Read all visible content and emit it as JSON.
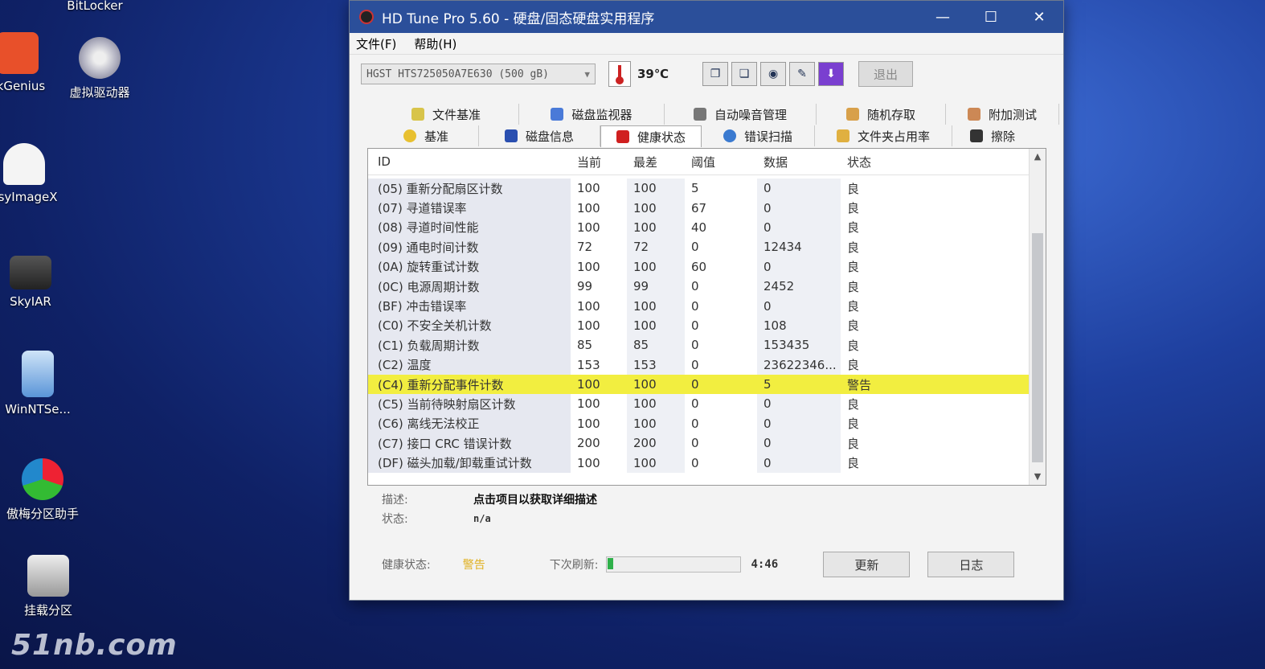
{
  "desktop": {
    "icons": [
      {
        "label": "BitLocker"
      },
      {
        "label": "skGenius"
      },
      {
        "label": "虚拟驱动器"
      },
      {
        "label": "asyImageX"
      },
      {
        "label": "SkyIAR"
      },
      {
        "label": "WinNTSe..."
      },
      {
        "label": "傲梅分区助手"
      },
      {
        "label": "挂载分区"
      }
    ],
    "watermark": "51nb.com"
  },
  "window": {
    "title": "HD Tune Pro 5.60 - 硬盘/固态硬盘实用程序",
    "minimize": "—",
    "maximize": "☐",
    "close": "✕"
  },
  "menu": {
    "file": "文件(F)",
    "help": "帮助(H)"
  },
  "toolbar": {
    "drive": "HGST HTS725050A7E630 (500 gB)",
    "temperature": "39℃",
    "exit_label": "退出"
  },
  "tabs": {
    "row1": [
      "文件基准",
      "磁盘监视器",
      "自动噪音管理",
      "随机存取",
      "附加测试"
    ],
    "row2": [
      "基准",
      "磁盘信息",
      "健康状态",
      "错误扫描",
      "文件夹占用率",
      "擦除"
    ],
    "active": "健康状态"
  },
  "table": {
    "headers": {
      "id": "ID",
      "current": "当前",
      "worst": "最差",
      "threshold": "阈值",
      "data": "数据",
      "status": "状态"
    },
    "rows": [
      {
        "id": "(05) 重新分配扇区计数",
        "current": "100",
        "worst": "100",
        "threshold": "5",
        "data": "0",
        "status": "良"
      },
      {
        "id": "(07) 寻道错误率",
        "current": "100",
        "worst": "100",
        "threshold": "67",
        "data": "0",
        "status": "良"
      },
      {
        "id": "(08) 寻道时间性能",
        "current": "100",
        "worst": "100",
        "threshold": "40",
        "data": "0",
        "status": "良"
      },
      {
        "id": "(09) 通电时间计数",
        "current": "72",
        "worst": "72",
        "threshold": "0",
        "data": "12434",
        "status": "良"
      },
      {
        "id": "(0A) 旋转重试计数",
        "current": "100",
        "worst": "100",
        "threshold": "60",
        "data": "0",
        "status": "良"
      },
      {
        "id": "(0C) 电源周期计数",
        "current": "99",
        "worst": "99",
        "threshold": "0",
        "data": "2452",
        "status": "良"
      },
      {
        "id": "(BF) 冲击错误率",
        "current": "100",
        "worst": "100",
        "threshold": "0",
        "data": "0",
        "status": "良"
      },
      {
        "id": "(C0) 不安全关机计数",
        "current": "100",
        "worst": "100",
        "threshold": "0",
        "data": "108",
        "status": "良"
      },
      {
        "id": "(C1) 负载周期计数",
        "current": "85",
        "worst": "85",
        "threshold": "0",
        "data": "153435",
        "status": "良"
      },
      {
        "id": "(C2) 温度",
        "current": "153",
        "worst": "153",
        "threshold": "0",
        "data": "23622346...",
        "status": "良"
      },
      {
        "id": "(C4) 重新分配事件计数",
        "current": "100",
        "worst": "100",
        "threshold": "0",
        "data": "5",
        "status": "警告"
      },
      {
        "id": "(C5) 当前待映射扇区计数",
        "current": "100",
        "worst": "100",
        "threshold": "0",
        "data": "0",
        "status": "良"
      },
      {
        "id": "(C6) 离线无法校正",
        "current": "100",
        "worst": "100",
        "threshold": "0",
        "data": "0",
        "status": "良"
      },
      {
        "id": "(C7) 接口 CRC 错误计数",
        "current": "200",
        "worst": "200",
        "threshold": "0",
        "data": "0",
        "status": "良"
      },
      {
        "id": "(DF) 磁头加载/卸载重试计数",
        "current": "100",
        "worst": "100",
        "threshold": "0",
        "data": "0",
        "status": "良"
      }
    ]
  },
  "details": {
    "desc_label": "描述:",
    "desc_value": "点击项目以获取详细描述",
    "status_label": "状态:",
    "status_value": "n/a"
  },
  "footer": {
    "health_label": "健康状态:",
    "health_value": "警告",
    "next_refresh_label": "下次刷新:",
    "progress": 0.04,
    "timer": "4:46",
    "update_btn": "更新",
    "log_btn": "日志"
  },
  "colors": {
    "title_bar": "#2b4f9a",
    "warning_row": "#f2ee40",
    "warning_text": "#e0b020",
    "progress_fill": "#2fb04a"
  }
}
